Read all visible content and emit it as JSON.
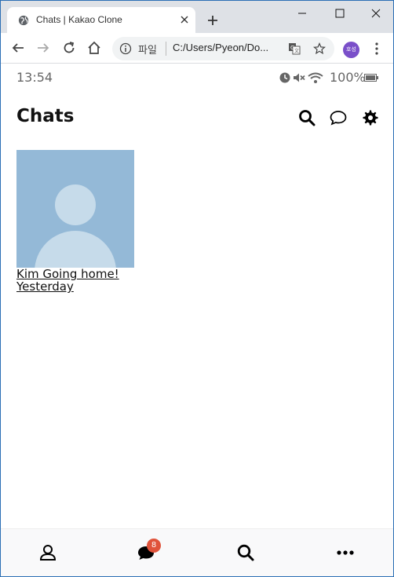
{
  "browser": {
    "tab_title": "Chats | Kakao Clone",
    "omnibox": {
      "scheme_label": "파일",
      "url": "C:/Users/Pyeon/Do..."
    },
    "profile_initials": "호성"
  },
  "status_bar": {
    "time": "13:54",
    "battery": "100%"
  },
  "header": {
    "title": "Chats"
  },
  "chats": [
    {
      "name_and_message": "Kim Going home!",
      "timestamp": "Yesterday"
    }
  ],
  "tab_bar": {
    "chat_badge_count": "8"
  },
  "icons": {
    "browser": [
      "globe-icon",
      "close-icon",
      "plus-icon",
      "minimize-icon",
      "maximize-icon",
      "window-close-icon",
      "back-arrow-icon",
      "forward-arrow-icon",
      "reload-icon",
      "home-icon",
      "info-icon",
      "translate-icon",
      "star-icon",
      "kebab-menu-icon"
    ],
    "status": [
      "alarm-icon",
      "mute-icon",
      "wifi-icon",
      "battery-icon"
    ],
    "header": [
      "search-icon",
      "new-chat-icon",
      "settings-icon"
    ],
    "tab_bar": [
      "person-icon",
      "chat-bubble-icon",
      "search-icon",
      "more-icon"
    ]
  },
  "colors": {
    "avatar_bg": "#94b9d7",
    "avatar_fg": "#c6dbea",
    "badge": "#e0533b",
    "profile": "#7a4fc9"
  }
}
